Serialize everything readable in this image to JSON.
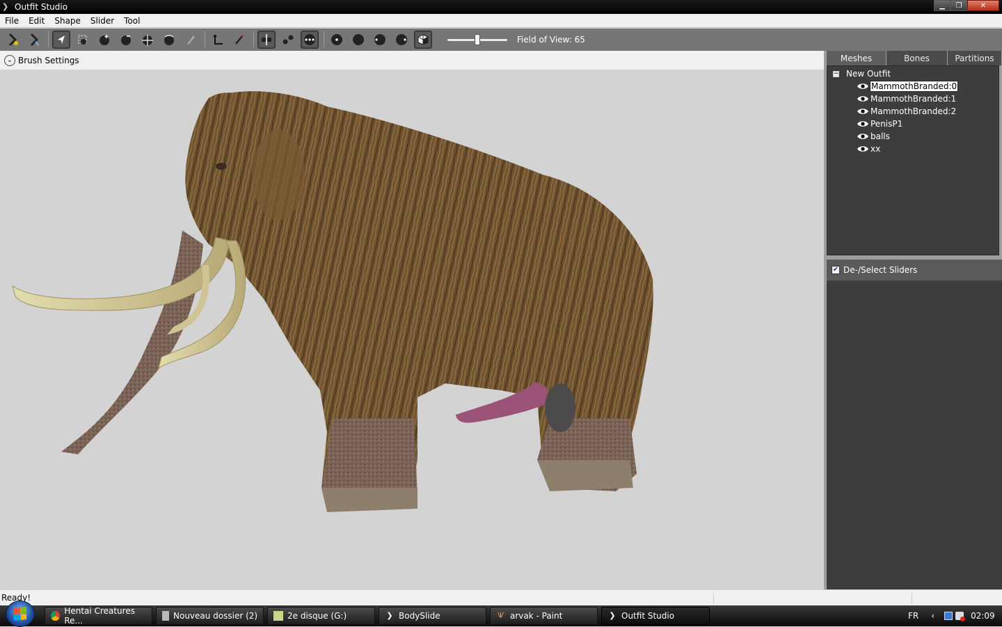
{
  "window": {
    "title": "Outfit Studio",
    "controls": {
      "minimize": "▁",
      "maximize": "❐",
      "close": "✕"
    }
  },
  "menu": [
    "File",
    "Edit",
    "Shape",
    "Slider",
    "Tool"
  ],
  "toolbar": {
    "tools": [
      {
        "name": "load-outfit-icon",
        "active": false
      },
      {
        "name": "load-reference-icon",
        "active": false
      },
      {
        "name": "select-brush-icon",
        "active": true
      },
      {
        "name": "mask-brush-icon",
        "active": false
      },
      {
        "name": "inflate-brush-icon",
        "active": false
      },
      {
        "name": "deflate-brush-icon",
        "active": false
      },
      {
        "name": "move-brush-icon",
        "active": false
      },
      {
        "name": "smooth-brush-icon",
        "active": false
      },
      {
        "name": "weight-brush-icon",
        "active": false
      },
      {
        "name": "transform-icon",
        "active": false
      },
      {
        "name": "pivot-icon",
        "active": false
      },
      {
        "name": "x-mirror-icon",
        "active": true
      },
      {
        "name": "connected-only-icon",
        "active": false
      },
      {
        "name": "global-brush-icon",
        "active": true
      },
      {
        "name": "show-wireframe-icon",
        "active": false
      },
      {
        "name": "show-lighting-icon",
        "active": false
      },
      {
        "name": "show-texture-icon",
        "active": false
      },
      {
        "name": "show-vertex-colors-icon",
        "active": false
      },
      {
        "name": "show-mesh-icon",
        "active": true
      }
    ],
    "fov_value": 65,
    "fov_min": 0,
    "fov_max": 100,
    "fov_label": "Field of View: 65"
  },
  "brush_settings": {
    "label": "Brush Settings",
    "icon": "chevron-down-icon"
  },
  "panel": {
    "tabs": [
      {
        "label": "Meshes",
        "active": true
      },
      {
        "label": "Bones",
        "active": false
      },
      {
        "label": "Partitions",
        "active": false
      }
    ],
    "tree_root": "New Outfit",
    "meshes": [
      {
        "label": "MammothBranded:0",
        "selected": true
      },
      {
        "label": "MammothBranded:1",
        "selected": false
      },
      {
        "label": "MammothBranded:2",
        "selected": false
      },
      {
        "label": "PenisP1",
        "selected": false
      },
      {
        "label": "balls",
        "selected": false
      },
      {
        "label": "xx",
        "selected": false
      }
    ],
    "slider_toggle": {
      "label": "De-/Select Sliders",
      "checked": true
    }
  },
  "status": {
    "text": "Ready!"
  },
  "taskbar": {
    "tasks": [
      {
        "label": "Hentai Creatures Re...",
        "icon": "chrome-icon",
        "active": false
      },
      {
        "label": "Nouveau dossier (2)",
        "icon": "folder-icon",
        "active": false
      },
      {
        "label": "2e disque (G:)",
        "icon": "drive-icon",
        "active": false
      },
      {
        "label": "BodySlide",
        "icon": "bodyslide-icon",
        "active": false
      },
      {
        "label": "arvak - Paint",
        "icon": "paint-icon",
        "active": false
      },
      {
        "label": "Outfit Studio",
        "icon": "outfit-studio-icon",
        "active": true
      }
    ],
    "language": "FR",
    "clock": "02:09"
  },
  "colors": {
    "toolbar_bg": "#767676",
    "panel_bg": "#3d3d3d",
    "viewport_bg": "#d3d3d3",
    "fur": "#6e5230",
    "tusk": "#d8d0a0",
    "trunk": "#7a5c4c",
    "pink": "#9a5276"
  }
}
